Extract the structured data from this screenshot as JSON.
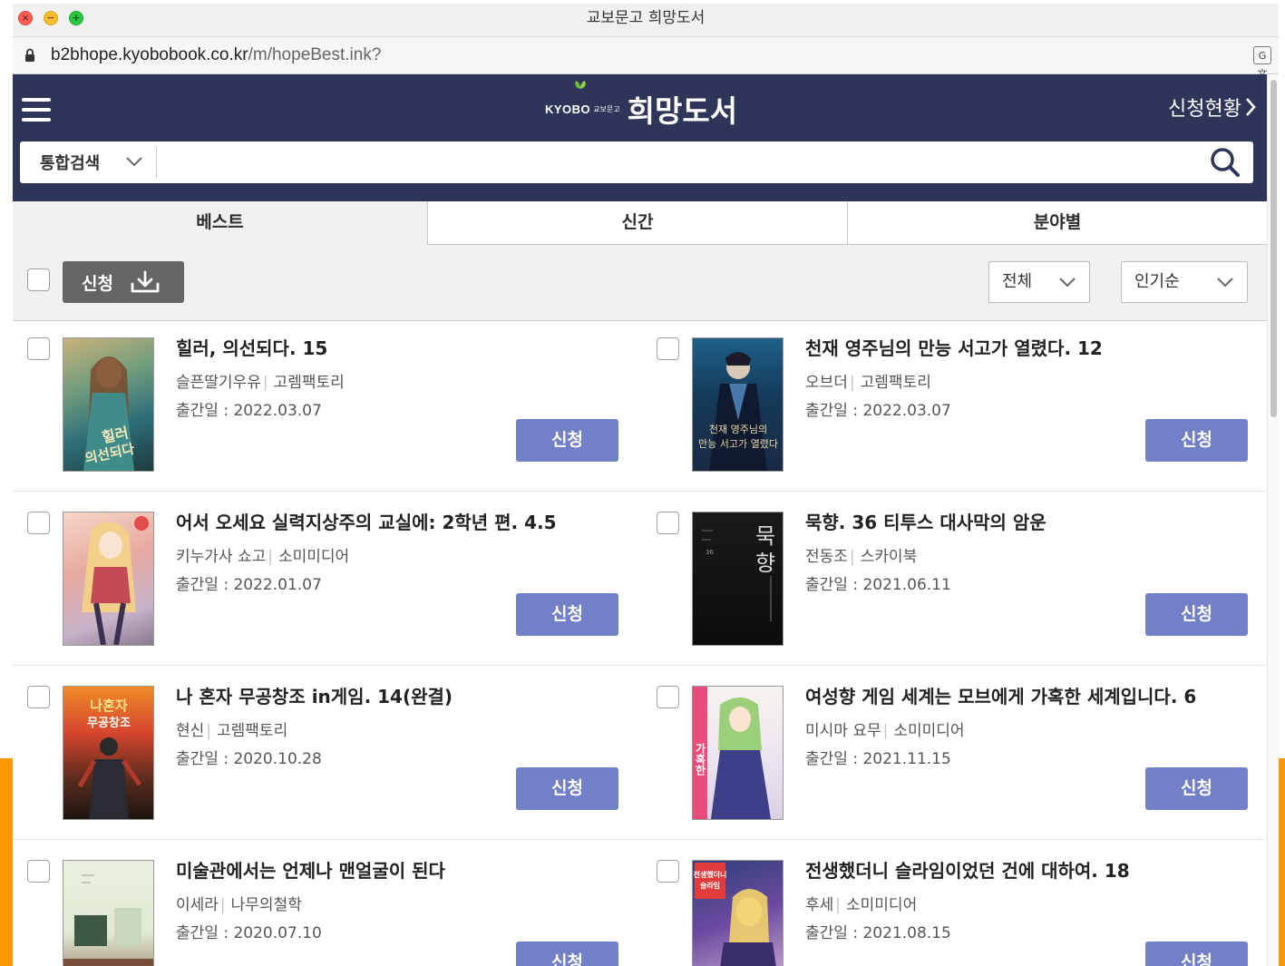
{
  "window": {
    "title": "교보문고 희망도서"
  },
  "address_bar": {
    "host": "b2bhope.kyobobook.co.kr",
    "path": "/m/hopeBest.ink?"
  },
  "header": {
    "logo_brand": "KYOBO",
    "logo_mini": "교보문고",
    "site_name": "희망도서",
    "status_link": "신청현황"
  },
  "search": {
    "scope": "통합검색",
    "query": ""
  },
  "tabs": [
    {
      "label": "베스트",
      "active": true
    },
    {
      "label": "신간",
      "active": false
    },
    {
      "label": "분야별",
      "active": false
    }
  ],
  "toolbar": {
    "apply_all_label": "신청",
    "filter": "전체",
    "sort": "인기순"
  },
  "books": [
    {
      "title": "힐러, 의선되다. 15",
      "author": "슬픈딸기우유",
      "publisher": "고렘팩토리",
      "pub_date": "출간일 : 2022.03.07",
      "action": "신청",
      "cover_text": "힐러 의선되다"
    },
    {
      "title": "천재 영주님의 만능 서고가 열렸다. 12",
      "author": "오브더",
      "publisher": "고렘팩토리",
      "pub_date": "출간일 : 2022.03.07",
      "action": "신청",
      "cover_text": "천재 영주님의 만능 서고가 열렸다"
    },
    {
      "title": "어서 오세요 실력지상주의 교실에: 2학년 편. 4.5",
      "author": "키누가사 쇼고",
      "publisher": "소미미디어",
      "pub_date": "출간일 : 2022.01.07",
      "action": "신청",
      "cover_text": ""
    },
    {
      "title": "묵향. 36 티투스 대사막의 암운",
      "author": "전동조",
      "publisher": "스카이북",
      "pub_date": "출간일 : 2021.06.11",
      "action": "신청",
      "cover_text": "묵향"
    },
    {
      "title": "나 혼자 무공창조 in게임. 14(완결)",
      "author": "현신",
      "publisher": "고렘팩토리",
      "pub_date": "출간일 : 2020.10.28",
      "action": "신청",
      "cover_text": "나 혼자 무공창조"
    },
    {
      "title": "여성향 게임 세계는 모브에게 가혹한 세계입니다. 6",
      "author": "미시마 요무",
      "publisher": "소미미디어",
      "pub_date": "출간일 : 2021.11.15",
      "action": "신청",
      "cover_text": "가혹한"
    },
    {
      "title": "미술관에서는 언제나 맨얼굴이 된다",
      "author": "이세라",
      "publisher": "나무의철학",
      "pub_date": "출간일 : 2020.07.10",
      "action": "신청",
      "cover_text": ""
    },
    {
      "title": "전생했더니 슬라임이었던 건에 대하여. 18",
      "author": "후세",
      "publisher": "소미미디어",
      "pub_date": "출간일 : 2021.08.15",
      "action": "신청",
      "cover_text": "전생했더니 슬라임이었던"
    }
  ],
  "colors": {
    "header_bg": "#2f3558",
    "apply_button": "#7280c8",
    "toolbar_bg": "#f0f0f0",
    "accent_frame": "#ff9800"
  }
}
